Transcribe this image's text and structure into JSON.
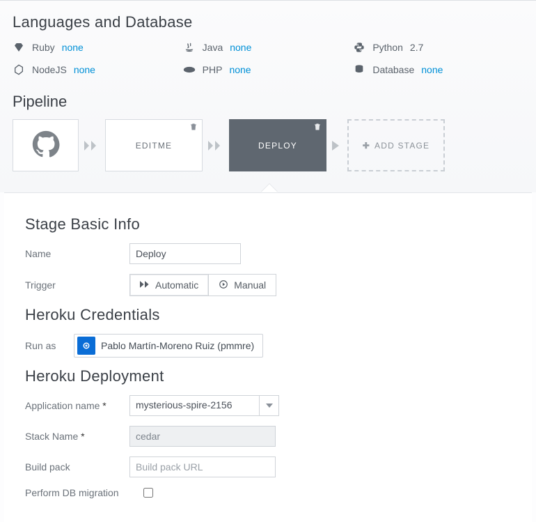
{
  "lang_section": {
    "title": "Languages and Database",
    "items": [
      {
        "icon": "gem-icon",
        "label": "Ruby",
        "value": "none",
        "link": true
      },
      {
        "icon": "java-icon",
        "label": "Java",
        "value": "none",
        "link": true
      },
      {
        "icon": "python-icon",
        "label": "Python",
        "value": "2.7",
        "link": false
      },
      {
        "icon": "nodejs-icon",
        "label": "NodeJS",
        "value": "none",
        "link": true
      },
      {
        "icon": "php-icon",
        "label": "PHP",
        "value": "none",
        "link": true
      },
      {
        "icon": "database-icon",
        "label": "Database",
        "value": "none",
        "link": true
      }
    ]
  },
  "pipeline": {
    "title": "Pipeline",
    "stages": [
      {
        "type": "source",
        "label": ""
      },
      {
        "type": "stage",
        "label": "EDITME"
      },
      {
        "type": "stage",
        "label": "DEPLOY",
        "selected": true
      },
      {
        "type": "add",
        "label": "ADD STAGE"
      }
    ]
  },
  "basic": {
    "title": "Stage Basic Info",
    "name_label": "Name",
    "name_value": "Deploy",
    "trigger_label": "Trigger",
    "trigger_auto": "Automatic",
    "trigger_manual": "Manual"
  },
  "creds": {
    "title": "Heroku Credentials",
    "runas_label": "Run as",
    "runas_value": "Pablo Martín-Moreno Ruiz (pmmre)"
  },
  "deploy": {
    "title": "Heroku Deployment",
    "app_label": "Application name",
    "app_value": "mysterious-spire-2156",
    "stack_label": "Stack Name",
    "stack_value": "cedar",
    "buildpack_label": "Build pack",
    "buildpack_placeholder": "Build pack URL",
    "dbm_label": "Perform DB migration"
  }
}
